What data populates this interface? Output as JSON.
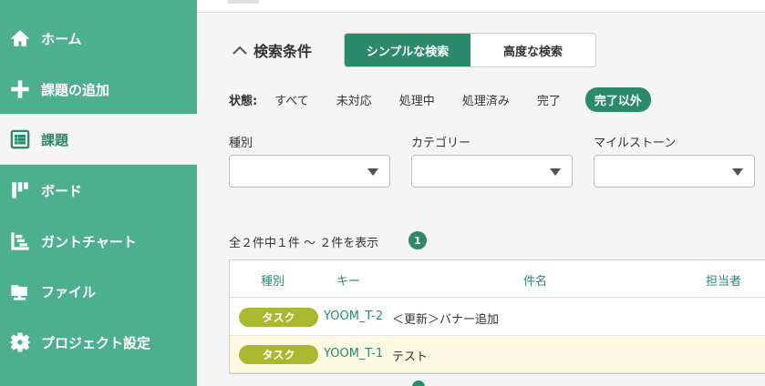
{
  "sidebar": {
    "items": [
      {
        "label": "ホーム",
        "icon": "home-icon"
      },
      {
        "label": "課題の追加",
        "icon": "plus-icon"
      },
      {
        "label": "課題",
        "icon": "list-icon",
        "active": true
      },
      {
        "label": "ボード",
        "icon": "board-icon"
      },
      {
        "label": "ガントチャート",
        "icon": "gantt-chart-icon"
      },
      {
        "label": "ファイル",
        "icon": "folder-icon"
      },
      {
        "label": "プロジェクト設定",
        "icon": "gear-icon"
      }
    ]
  },
  "search": {
    "title": "検索条件",
    "tabs": [
      "シンプルな検索",
      "高度な検索"
    ],
    "active_tab": "シンプルな検索"
  },
  "status": {
    "label": "状態:",
    "options": [
      "すべて",
      "未対応",
      "処理中",
      "処理済み",
      "完了",
      "完了以外"
    ],
    "active": "完了以外"
  },
  "filters": {
    "type_label": "種別",
    "category_label": "カテゴリー",
    "milestone_label": "マイルストーン"
  },
  "results": {
    "summary": "全２件中１件 〜 ２件を表示",
    "page": "1"
  },
  "table": {
    "headers": [
      "種別",
      "キー",
      "件名",
      "担当者"
    ],
    "rows": [
      {
        "type": "タスク",
        "key": "YOOM_T-2",
        "subject": "＜更新＞バナー追加"
      },
      {
        "type": "タスク",
        "key": "YOOM_T-1",
        "subject": "テスト"
      }
    ]
  },
  "colors": {
    "sidebar": "#4caf8e",
    "accent": "#2a8a6b",
    "task_badge": "#a8b92f",
    "row_highlight": "#fdf8e1"
  }
}
